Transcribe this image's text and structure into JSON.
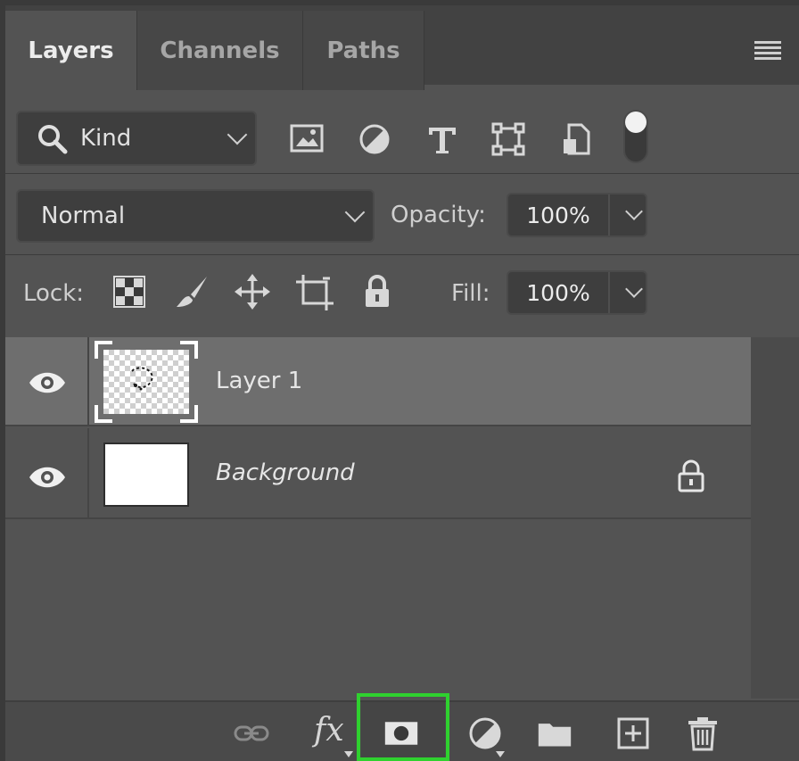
{
  "tabs": [
    {
      "label": "Layers",
      "active": true
    },
    {
      "label": "Channels",
      "active": false
    },
    {
      "label": "Paths",
      "active": false
    }
  ],
  "filter": {
    "kind_label": "Kind"
  },
  "blend": {
    "mode": "Normal",
    "opacity_label": "Opacity:",
    "opacity_value": "100%"
  },
  "lock": {
    "label": "Lock:",
    "fill_label": "Fill:",
    "fill_value": "100%"
  },
  "layers": [
    {
      "name": "Layer 1",
      "selected": true,
      "visible": true,
      "thumbnail": "transparent"
    },
    {
      "name": "Background",
      "selected": false,
      "visible": true,
      "locked": true,
      "thumbnail": "white"
    }
  ],
  "footer": {
    "icons": [
      "link-icon",
      "fx-icon",
      "add-mask-icon",
      "adjustment-icon",
      "folder-icon",
      "new-layer-icon",
      "trash-icon"
    ],
    "fx_label": "fx",
    "highlight_color": "#2fd12f"
  },
  "colors": {
    "panel": "#535353",
    "selected_layer": "#6e6e6e",
    "highlight": "#2fd12f"
  }
}
